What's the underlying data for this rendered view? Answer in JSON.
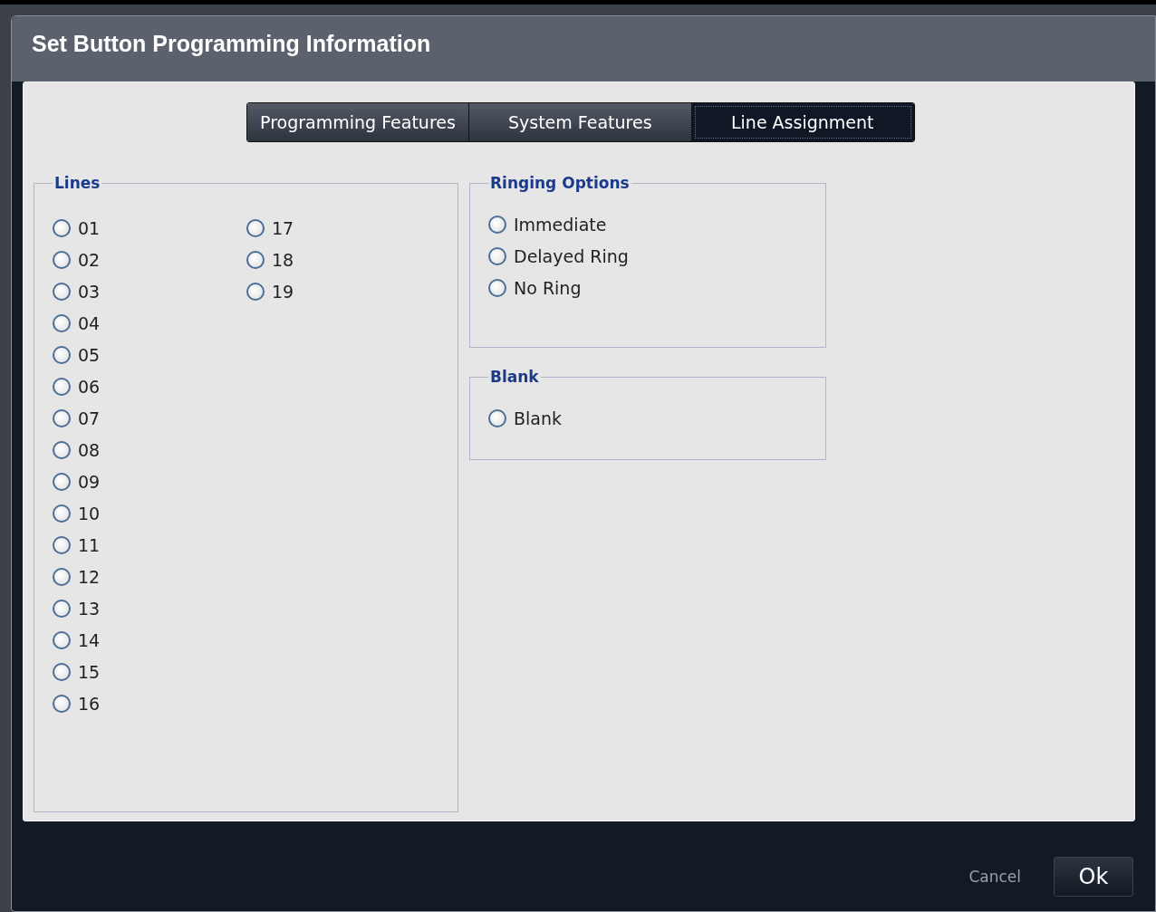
{
  "dialog": {
    "title": "Set Button Programming Information"
  },
  "tabs": [
    {
      "label": "Programming Features",
      "selected": false
    },
    {
      "label": "System Features",
      "selected": false
    },
    {
      "label": "Line Assignment",
      "selected": true
    }
  ],
  "lines": {
    "title": "Lines",
    "options": [
      {
        "label": "01",
        "selected": false
      },
      {
        "label": "02",
        "selected": false
      },
      {
        "label": "03",
        "selected": false
      },
      {
        "label": "04",
        "selected": false
      },
      {
        "label": "05",
        "selected": false
      },
      {
        "label": "06",
        "selected": false
      },
      {
        "label": "07",
        "selected": false
      },
      {
        "label": "08",
        "selected": false
      },
      {
        "label": "09",
        "selected": false
      },
      {
        "label": "10",
        "selected": false
      },
      {
        "label": "11",
        "selected": false
      },
      {
        "label": "12",
        "selected": false
      },
      {
        "label": "13",
        "selected": false
      },
      {
        "label": "14",
        "selected": false
      },
      {
        "label": "15",
        "selected": false
      },
      {
        "label": "16",
        "selected": false
      },
      {
        "label": "17",
        "selected": false
      },
      {
        "label": "18",
        "selected": false
      },
      {
        "label": "19",
        "selected": false
      }
    ]
  },
  "ringing_options": {
    "title": "Ringing Options",
    "options": [
      {
        "label": "Immediate",
        "selected": false
      },
      {
        "label": "Delayed Ring",
        "selected": false
      },
      {
        "label": "No Ring",
        "selected": false
      }
    ]
  },
  "blank": {
    "title": "Blank",
    "options": [
      {
        "label": "Blank",
        "selected": false
      }
    ]
  },
  "buttons": {
    "cancel": "Cancel",
    "ok": "Ok"
  }
}
